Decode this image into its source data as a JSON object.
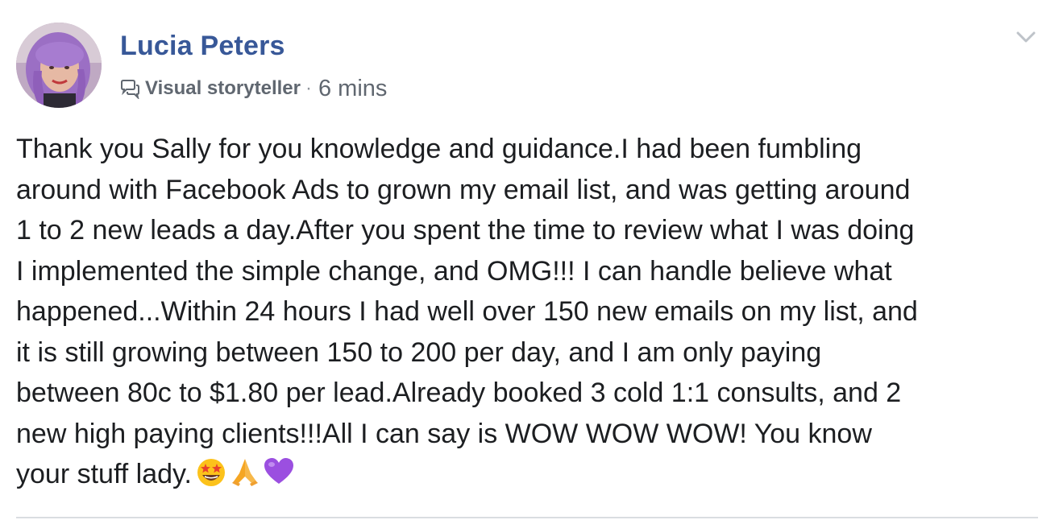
{
  "post": {
    "author": {
      "name": "Lucia Peters",
      "badge_label": "Visual storyteller",
      "badge_icon": "speech-bubble-icon"
    },
    "meta_separator": "·",
    "timestamp": "6 mins",
    "menu_icon": "chevron-down-icon",
    "body_lines": [
      "Thank you Sally for you knowledge and guidance.I had been fumbling",
      "around with Facebook Ads to grown my email list, and was getting around",
      "1 to 2 new leads a day.After you spent the time to review what I was doing",
      "I implemented the simple change, and OMG!!! I can handle believe what",
      "happened...Within 24 hours I had well over 150 new emails on my list, and",
      "it is still growing between 150 to 200 per day, and I am only paying",
      "between 80c to $1.80 per lead.Already booked 3 cold 1:1 consults, and 2",
      "new high paying clients!!!All I can say is WOW WOW WOW! You know",
      "your stuff lady."
    ],
    "emojis": [
      "star-struck-emoji-icon",
      "folded-hands-emoji-icon",
      "purple-heart-emoji-icon"
    ]
  },
  "colors": {
    "author_name": "#385898",
    "secondary_text": "#606770",
    "body_text": "#1c1e21",
    "divider": "#dadde1"
  }
}
